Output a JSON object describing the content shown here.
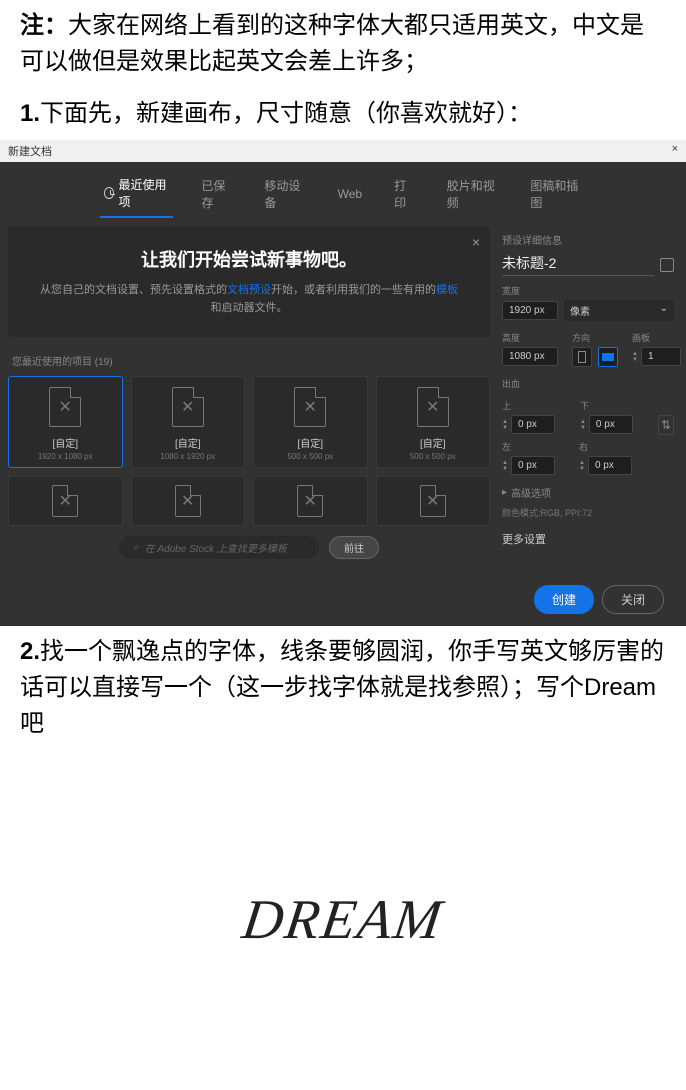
{
  "article": {
    "note_label": "注：",
    "note_text": "大家在网络上看到的这种字体大都只适用英文，中文是可以做但是效果比起英文会差上许多；",
    "step1_label": "1.",
    "step1_text": "下面先，新建画布，尺寸随意（你喜欢就好）：",
    "step2_label": "2.",
    "step2_text": "找一个飘逸点的字体，线条要够圆润，你手写英文够厉害的话可以直接写一个（这一步找字体就是找参照）；写个Dream吧"
  },
  "dialog": {
    "title": "新建文档",
    "tabs": [
      "最近使用项",
      "已保存",
      "移动设备",
      "Web",
      "打印",
      "胶片和视频",
      "图稿和插图"
    ],
    "hero_title": "让我们开始尝试新事物吧。",
    "hero_sub_1": "从您自己的文档设置、预先设置格式的",
    "hero_link_1": "文档预设",
    "hero_sub_2": "开始，或者利用我们的一些有用的",
    "hero_link_2": "模板",
    "hero_sub_3": "和启动器文件。",
    "recent_label": "您最近使用的项目 (19)",
    "presets": [
      {
        "name": "[自定]",
        "dims": "1920 x 1080 px"
      },
      {
        "name": "[自定]",
        "dims": "1080 x 1920 px"
      },
      {
        "name": "[自定]",
        "dims": "500 x 500 px"
      },
      {
        "name": "[自定]",
        "dims": "500 x 500 px"
      }
    ],
    "search_placeholder": "在 Adobe Stock 上查找更多模板",
    "go_label": "前往",
    "rp": {
      "header": "预设详细信息",
      "title": "未标题-2",
      "width_label": "宽度",
      "width_value": "1920 px",
      "unit": "像素",
      "height_label": "高度",
      "orient_label": "方向",
      "artboard_label": "画板",
      "height_value": "1080 px",
      "artboard_value": "1",
      "bleed_label": "出血",
      "top": "上",
      "bottom": "下",
      "left": "左",
      "right": "右",
      "bleed_val": "0 px",
      "advanced": "高级选项",
      "colormode": "颜色模式:RGB, PPI:72",
      "more": "更多设置"
    },
    "create": "创建",
    "close": "关闭"
  },
  "dream": "DREAM"
}
